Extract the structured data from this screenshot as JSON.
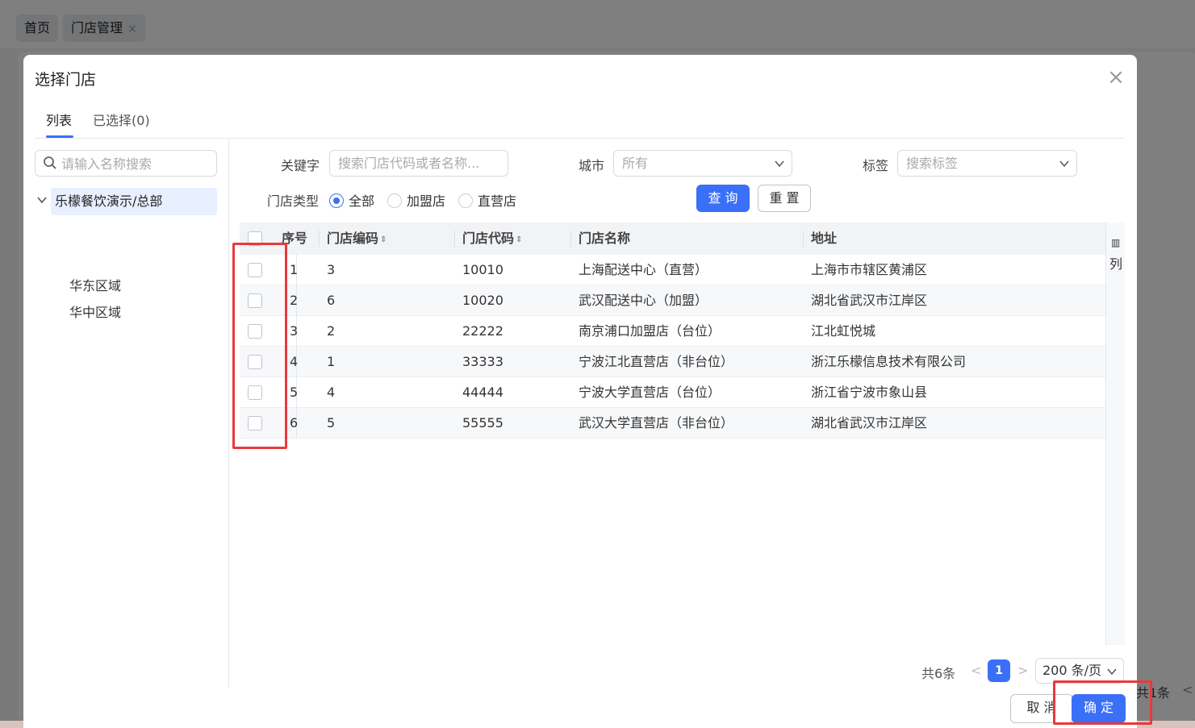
{
  "background": {
    "tabs": [
      {
        "label": "首页"
      },
      {
        "label": "门店管理",
        "close": "×"
      }
    ],
    "pager_text": "共1条",
    "pager_arrow": "<"
  },
  "modal": {
    "title": "选择门店",
    "close": "×",
    "tabs": [
      "列表",
      "已选择(0)"
    ],
    "tree": {
      "search_placeholder": "请输入名称搜索",
      "root": "乐檬餐饮演示/总部",
      "children": [
        "华东区域",
        "华中区域"
      ]
    },
    "filters": {
      "keyword_label": "关键字",
      "keyword_placeholder": "搜索门店代码或者名称...",
      "city_label": "城市",
      "city_value": "所有",
      "tag_label": "标签",
      "tag_placeholder": "搜索标签",
      "type_label": "门店类型",
      "type_options": [
        "全部",
        "加盟店",
        "直营店"
      ],
      "type_selected": "全部",
      "query_button": "查 询",
      "reset_button": "重 置"
    },
    "table": {
      "columns": [
        "序号",
        "门店编码",
        "门店代码",
        "门店名称",
        "地址"
      ],
      "rows": [
        [
          "1",
          "3",
          "10010",
          "上海配送中心（直营）",
          "上海市市辖区黄浦区"
        ],
        [
          "2",
          "6",
          "10020",
          "武汉配送中心（加盟）",
          "湖北省武汉市江岸区"
        ],
        [
          "3",
          "2",
          "22222",
          "南京浦口加盟店（台位）",
          "江北虹悦城"
        ],
        [
          "4",
          "1",
          "33333",
          "宁波江北直营店（非台位）",
          "浙江乐檬信息技术有限公司"
        ],
        [
          "5",
          "4",
          "44444",
          "宁波大学直营店（台位）",
          "浙江省宁波市象山县"
        ],
        [
          "6",
          "5",
          "55555",
          "武汉大学直营店（非台位）",
          "湖北省武汉市江岸区"
        ]
      ],
      "column_settings_label": "列"
    },
    "pagination": {
      "total": "共6条",
      "prev": "<",
      "page": "1",
      "next": ">",
      "page_size": "200 条/页"
    },
    "footer": {
      "cancel": "取 消",
      "confirm": "确 定"
    }
  },
  "colors": {
    "primary": "#3a6ff7",
    "highlight": "#e83a3a"
  }
}
